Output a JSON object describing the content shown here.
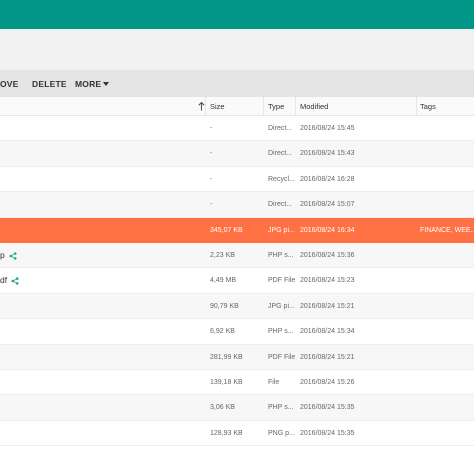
{
  "toolbar": {
    "move_label": "OVE",
    "delete_label": "DELETE",
    "more_label": "MORE"
  },
  "columns": {
    "size": "Size",
    "type": "Type",
    "modified": "Modified",
    "tags": "Tags"
  },
  "rows": [
    {
      "name": "",
      "size": "-",
      "type": "Direct...",
      "modified": "2016/08/24 15:45",
      "tags": "",
      "shared": false,
      "selected": false
    },
    {
      "name": "",
      "size": "-",
      "type": "Direct...",
      "modified": "2016/08/24 15:43",
      "tags": "",
      "shared": false,
      "selected": false
    },
    {
      "name": "",
      "size": "-",
      "type": "Recycl...",
      "modified": "2016/08/24 16:28",
      "tags": "",
      "shared": false,
      "selected": false
    },
    {
      "name": "",
      "size": "-",
      "type": "Direct...",
      "modified": "2016/08/24 15:07",
      "tags": "",
      "shared": false,
      "selected": false
    },
    {
      "name": "",
      "size": "345,07 KB",
      "type": "JPG pi...",
      "modified": "2016/08/24 16:34",
      "tags": "FINANCE, WEE...",
      "shared": false,
      "selected": true
    },
    {
      "name": "p",
      "size": "2,23 KB",
      "type": "PHP s...",
      "modified": "2016/08/24 15:36",
      "tags": "",
      "shared": true,
      "selected": false
    },
    {
      "name": "df",
      "size": "4,49 MB",
      "type": "PDF File",
      "modified": "2016/08/24 15:23",
      "tags": "",
      "shared": true,
      "selected": false
    },
    {
      "name": "",
      "size": "90,79 KB",
      "type": "JPG pi...",
      "modified": "2016/08/24 15:21",
      "tags": "",
      "shared": false,
      "selected": false
    },
    {
      "name": "",
      "size": "6,92 KB",
      "type": "PHP s...",
      "modified": "2016/08/24 15:34",
      "tags": "",
      "shared": false,
      "selected": false
    },
    {
      "name": "",
      "size": "281,99 KB",
      "type": "PDF File",
      "modified": "2016/08/24 15:21",
      "tags": "",
      "shared": false,
      "selected": false
    },
    {
      "name": "",
      "size": "139,18 KB",
      "type": "File",
      "modified": "2016/08/24 15:26",
      "tags": "",
      "shared": false,
      "selected": false
    },
    {
      "name": "",
      "size": "3,06 KB",
      "type": "PHP s...",
      "modified": "2016/08/24 15:35",
      "tags": "",
      "shared": false,
      "selected": false
    },
    {
      "name": "",
      "size": "128,93 KB",
      "type": "PNG p...",
      "modified": "2016/08/24 15:35",
      "tags": "",
      "shared": false,
      "selected": false
    }
  ],
  "colors": {
    "header": "#009688",
    "selected_row": "#ff7043",
    "share_icon": "#26a69a"
  }
}
